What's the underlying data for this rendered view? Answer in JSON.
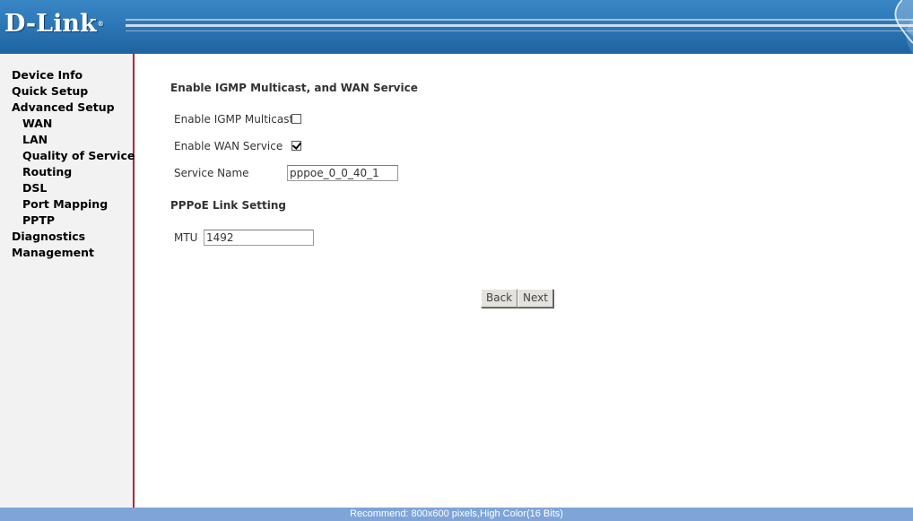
{
  "header": {
    "logo_text": "D-Link",
    "logo_mark": "®"
  },
  "sidebar": {
    "items": [
      {
        "label": "Device Info"
      },
      {
        "label": "Quick Setup"
      },
      {
        "label": "Advanced Setup"
      },
      {
        "label": "WAN"
      },
      {
        "label": "LAN"
      },
      {
        "label": "Quality of Service"
      },
      {
        "label": "Routing"
      },
      {
        "label": "DSL"
      },
      {
        "label": "Port Mapping"
      },
      {
        "label": "PPTP"
      },
      {
        "label": "Diagnostics"
      },
      {
        "label": "Management"
      }
    ]
  },
  "form": {
    "title": "Enable IGMP Multicast, and WAN Service",
    "igmp": {
      "label": "Enable IGMP Multicast",
      "checked": false
    },
    "wan_service": {
      "label": "Enable WAN Service",
      "checked": true
    },
    "service_name": {
      "label": "Service Name",
      "value": "pppoe_0_0_40_1"
    },
    "pppoe_title": "PPPoE Link Setting",
    "mtu": {
      "label": "MTU",
      "value": "1492"
    },
    "back_label": "Back",
    "next_label": "Next"
  },
  "footer": {
    "text": "Recommend: 800x600 pixels,High Color(16 Bits)"
  },
  "colors": {
    "header_blue": "#2a74b3",
    "sidebar_border": "#b0283a",
    "footer_blue": "#7ea4d8"
  }
}
